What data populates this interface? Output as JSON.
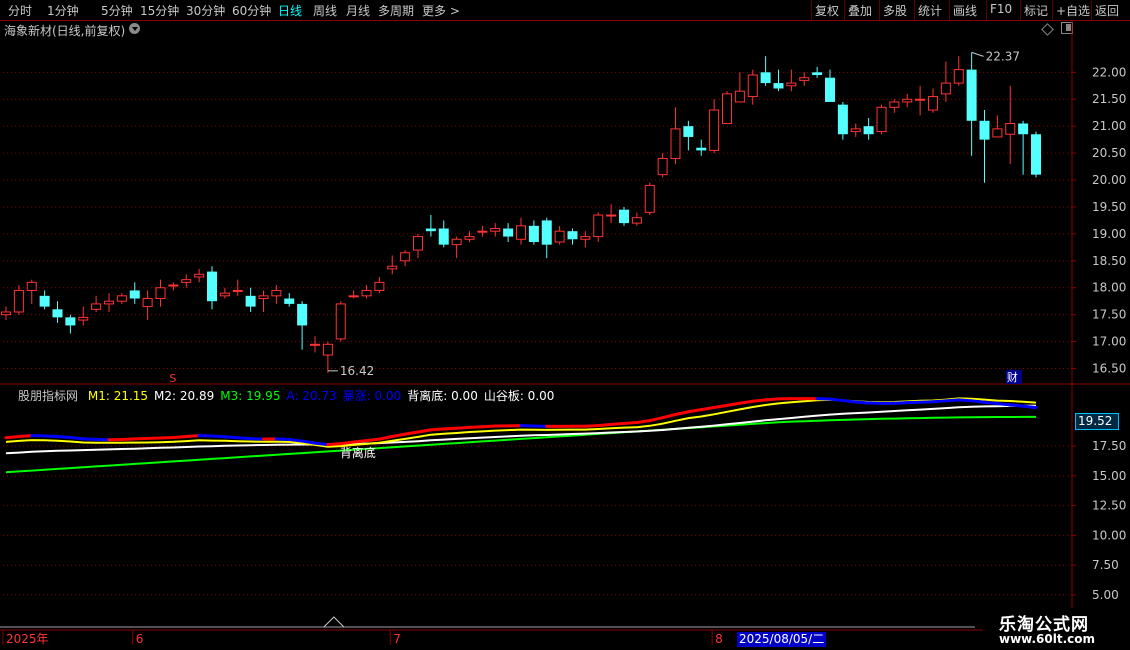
{
  "toolbar": {
    "left": [
      {
        "label": "分时",
        "active": false
      },
      {
        "label": "1分钟",
        "active": false
      },
      {
        "label": "5分钟",
        "active": false
      },
      {
        "label": "15分钟",
        "active": false
      },
      {
        "label": "30分钟",
        "active": false
      },
      {
        "label": "60分钟",
        "active": false
      },
      {
        "label": "日线",
        "active": true
      },
      {
        "label": "周线",
        "active": false
      },
      {
        "label": "月线",
        "active": false
      },
      {
        "label": "多周期",
        "active": false
      },
      {
        "label": "更多 >",
        "active": false
      }
    ],
    "right": [
      "复权",
      "叠加",
      "多股",
      "统计",
      "画线",
      "F10",
      "标记",
      "+自选",
      "返回"
    ]
  },
  "chart_title": "海象新材(日线,前复权)",
  "main_chart": {
    "type": "candlestick",
    "y_ticks": [
      "22.00",
      "21.50",
      "21.00",
      "20.50",
      "20.00",
      "19.50",
      "19.00",
      "18.50",
      "18.00",
      "17.50",
      "17.00",
      "16.50"
    ],
    "ylim": [
      16.25,
      22.6
    ],
    "high_label": "22.37",
    "low_label": "16.42",
    "marker_s": "S",
    "marker_cai": "财",
    "candles": [
      [
        17.5,
        17.55,
        17.4,
        17.65
      ],
      [
        17.55,
        17.95,
        17.5,
        18.05
      ],
      [
        17.95,
        18.1,
        17.7,
        18.15
      ],
      [
        17.85,
        17.65,
        17.6,
        17.95
      ],
      [
        17.6,
        17.45,
        17.35,
        17.75
      ],
      [
        17.45,
        17.3,
        17.15,
        17.5
      ],
      [
        17.4,
        17.45,
        17.3,
        17.65
      ],
      [
        17.6,
        17.7,
        17.55,
        17.85
      ],
      [
        17.7,
        17.75,
        17.55,
        17.9
      ],
      [
        17.75,
        17.85,
        17.7,
        17.9
      ],
      [
        17.95,
        17.8,
        17.7,
        18.1
      ],
      [
        17.65,
        17.8,
        17.4,
        17.95
      ],
      [
        17.8,
        18.0,
        17.65,
        18.15
      ],
      [
        18.05,
        18.05,
        17.95,
        18.1
      ],
      [
        18.1,
        18.15,
        18.0,
        18.25
      ],
      [
        18.2,
        18.25,
        18.1,
        18.35
      ],
      [
        18.3,
        17.75,
        17.6,
        18.4
      ],
      [
        17.85,
        17.9,
        17.8,
        18.0
      ],
      [
        17.95,
        17.95,
        17.85,
        18.15
      ],
      [
        17.85,
        17.65,
        17.55,
        18.0
      ],
      [
        17.8,
        17.85,
        17.55,
        17.95
      ],
      [
        17.85,
        17.95,
        17.7,
        18.05
      ],
      [
        17.8,
        17.7,
        17.65,
        17.9
      ],
      [
        17.7,
        17.3,
        16.85,
        17.75
      ],
      [
        16.95,
        16.95,
        16.8,
        17.1
      ],
      [
        16.75,
        16.95,
        16.42,
        17.0
      ],
      [
        17.05,
        17.7,
        17.0,
        17.75
      ],
      [
        17.85,
        17.85,
        17.8,
        17.95
      ],
      [
        17.85,
        17.95,
        17.8,
        18.05
      ],
      [
        17.95,
        18.1,
        17.9,
        18.2
      ],
      [
        18.35,
        18.4,
        18.25,
        18.6
      ],
      [
        18.5,
        18.65,
        18.4,
        18.7
      ],
      [
        18.7,
        18.95,
        18.55,
        19.0
      ],
      [
        19.1,
        19.05,
        18.95,
        19.35
      ],
      [
        19.1,
        18.8,
        18.75,
        19.25
      ],
      [
        18.8,
        18.9,
        18.55,
        18.95
      ],
      [
        18.9,
        18.95,
        18.85,
        19.05
      ],
      [
        19.05,
        19.05,
        18.95,
        19.15
      ],
      [
        19.05,
        19.1,
        18.95,
        19.2
      ],
      [
        19.1,
        18.95,
        18.85,
        19.2
      ],
      [
        18.9,
        19.15,
        18.8,
        19.3
      ],
      [
        19.15,
        18.85,
        18.8,
        19.25
      ],
      [
        19.25,
        18.8,
        18.55,
        19.3
      ],
      [
        18.85,
        19.05,
        18.8,
        19.15
      ],
      [
        19.05,
        18.9,
        18.8,
        19.1
      ],
      [
        18.9,
        18.95,
        18.75,
        19.05
      ],
      [
        18.95,
        19.35,
        18.85,
        19.4
      ],
      [
        19.35,
        19.35,
        19.2,
        19.55
      ],
      [
        19.45,
        19.2,
        19.15,
        19.5
      ],
      [
        19.2,
        19.3,
        19.15,
        19.4
      ],
      [
        19.4,
        19.9,
        19.35,
        19.95
      ],
      [
        20.1,
        20.4,
        20.05,
        20.5
      ],
      [
        20.4,
        20.95,
        20.3,
        21.35
      ],
      [
        21.0,
        20.8,
        20.55,
        21.1
      ],
      [
        20.6,
        20.55,
        20.45,
        20.75
      ],
      [
        20.55,
        21.3,
        20.5,
        21.5
      ],
      [
        21.05,
        21.6,
        21.05,
        21.65
      ],
      [
        21.45,
        21.65,
        21.45,
        22.0
      ],
      [
        21.55,
        21.95,
        21.4,
        22.05
      ],
      [
        22.0,
        21.8,
        21.75,
        22.3
      ],
      [
        21.8,
        21.7,
        21.65,
        22.05
      ],
      [
        21.75,
        21.8,
        21.65,
        22.05
      ],
      [
        21.85,
        21.9,
        21.75,
        22.0
      ],
      [
        22.0,
        21.95,
        21.9,
        22.1
      ],
      [
        21.9,
        21.45,
        21.45,
        22.05
      ],
      [
        21.4,
        20.85,
        20.75,
        21.45
      ],
      [
        20.9,
        20.95,
        20.8,
        21.05
      ],
      [
        21.0,
        20.85,
        20.75,
        21.15
      ],
      [
        20.9,
        21.35,
        20.85,
        21.4
      ],
      [
        21.35,
        21.45,
        21.25,
        21.5
      ],
      [
        21.45,
        21.5,
        21.35,
        21.6
      ],
      [
        21.5,
        21.5,
        21.2,
        21.75
      ],
      [
        21.3,
        21.55,
        21.25,
        21.7
      ],
      [
        21.6,
        21.8,
        21.45,
        22.2
      ],
      [
        21.8,
        22.05,
        21.75,
        22.3
      ],
      [
        22.05,
        21.1,
        20.45,
        22.37
      ],
      [
        21.1,
        20.75,
        19.95,
        21.3
      ],
      [
        20.8,
        20.95,
        20.85,
        21.2
      ],
      [
        20.85,
        21.05,
        20.3,
        21.75
      ],
      [
        21.05,
        20.85,
        20.1,
        21.1
      ],
      [
        20.85,
        20.1,
        20.05,
        20.9
      ]
    ]
  },
  "sub_chart": {
    "indicator": "股朋指标网",
    "legend": [
      {
        "key": "M1",
        "value": "21.15",
        "color": "#ffff00"
      },
      {
        "key": "M2",
        "value": "20.89",
        "color": "#ffffff"
      },
      {
        "key": "M3",
        "value": "19.95",
        "color": "#00ff00"
      },
      {
        "key": "A",
        "value": "20.73",
        "color": "#0000ff"
      },
      {
        "key": "暴涨",
        "value": "0.00",
        "color": "#0000ff"
      },
      {
        "key": "背离底",
        "value": "0.00",
        "color": "#ffffff"
      },
      {
        "key": "山谷板",
        "value": "0.00",
        "color": "#ffffff"
      }
    ],
    "y_ticks": [
      "17.50",
      "15.00",
      "12.50",
      "10.00",
      "7.50",
      "5.00"
    ],
    "ylim": [
      3.9,
      21.2
    ],
    "current_value": "19.52",
    "annotation": "背离底",
    "series": {
      "M1": [
        17.85,
        17.93,
        18.0,
        17.98,
        17.95,
        17.88,
        17.8,
        17.78,
        17.77,
        17.78,
        17.79,
        17.8,
        17.82,
        17.86,
        17.92,
        17.98,
        17.96,
        17.94,
        17.91,
        17.88,
        17.86,
        17.87,
        17.85,
        17.75,
        17.6,
        17.45,
        17.5,
        17.6,
        17.68,
        17.78,
        17.95,
        18.1,
        18.27,
        18.45,
        18.53,
        18.6,
        18.68,
        18.73,
        18.8,
        18.84,
        18.88,
        18.87,
        18.86,
        18.87,
        18.88,
        18.88,
        18.93,
        19.0,
        19.05,
        19.08,
        19.2,
        19.38,
        19.62,
        19.85,
        19.98,
        20.17,
        20.38,
        20.58,
        20.78,
        20.95,
        21.08,
        21.18,
        21.27,
        21.35,
        21.38,
        21.33,
        21.27,
        21.2,
        21.18,
        21.2,
        21.25,
        21.3,
        21.33,
        21.4,
        21.5,
        21.48,
        21.4,
        21.32,
        21.28,
        21.22,
        21.15
      ],
      "M2": [
        16.9,
        16.95,
        17.02,
        17.06,
        17.1,
        17.13,
        17.16,
        17.19,
        17.22,
        17.25,
        17.28,
        17.31,
        17.35,
        17.38,
        17.42,
        17.46,
        17.49,
        17.52,
        17.55,
        17.57,
        17.59,
        17.61,
        17.62,
        17.63,
        17.63,
        17.63,
        17.65,
        17.68,
        17.71,
        17.75,
        17.8,
        17.85,
        17.91,
        17.98,
        18.04,
        18.1,
        18.15,
        18.21,
        18.26,
        18.31,
        18.36,
        18.4,
        18.43,
        18.47,
        18.51,
        18.55,
        18.59,
        18.64,
        18.68,
        18.72,
        18.78,
        18.85,
        18.94,
        19.03,
        19.12,
        19.22,
        19.33,
        19.44,
        19.55,
        19.66,
        19.76,
        19.86,
        19.96,
        20.06,
        20.14,
        20.21,
        20.27,
        20.32,
        20.38,
        20.44,
        20.5,
        20.56,
        20.62,
        20.69,
        20.76,
        20.8,
        20.83,
        20.85,
        20.87,
        20.88,
        20.89
      ],
      "M3": [
        15.3,
        15.37,
        15.44,
        15.51,
        15.58,
        15.65,
        15.72,
        15.79,
        15.86,
        15.93,
        16.0,
        16.07,
        16.14,
        16.21,
        16.28,
        16.35,
        16.42,
        16.49,
        16.56,
        16.63,
        16.7,
        16.77,
        16.84,
        16.91,
        16.98,
        17.05,
        17.12,
        17.19,
        17.26,
        17.33,
        17.4,
        17.47,
        17.54,
        17.61,
        17.68,
        17.75,
        17.82,
        17.89,
        17.96,
        18.03,
        18.1,
        18.17,
        18.24,
        18.31,
        18.38,
        18.45,
        18.52,
        18.59,
        18.66,
        18.73,
        18.8,
        18.87,
        18.94,
        19.01,
        19.08,
        19.15,
        19.22,
        19.29,
        19.36,
        19.43,
        19.5,
        19.55,
        19.59,
        19.63,
        19.67,
        19.7,
        19.73,
        19.76,
        19.79,
        19.81,
        19.83,
        19.85,
        19.87,
        19.89,
        19.91,
        19.92,
        19.93,
        19.94,
        19.94,
        19.95,
        19.95
      ],
      "A": [
        18.2,
        18.3,
        18.38,
        18.35,
        18.3,
        18.22,
        18.1,
        18.06,
        18.03,
        18.05,
        18.1,
        18.14,
        18.18,
        18.22,
        18.3,
        18.38,
        18.34,
        18.28,
        18.2,
        18.12,
        18.08,
        18.1,
        18.05,
        17.92,
        17.75,
        17.62,
        17.7,
        17.84,
        17.96,
        18.08,
        18.3,
        18.5,
        18.68,
        18.86,
        18.94,
        19.0,
        19.07,
        19.12,
        19.18,
        19.2,
        19.22,
        19.18,
        19.15,
        19.15,
        19.16,
        19.16,
        19.22,
        19.32,
        19.4,
        19.48,
        19.64,
        19.88,
        20.15,
        20.38,
        20.56,
        20.74,
        20.92,
        21.1,
        21.26,
        21.38,
        21.46,
        21.48,
        21.48,
        21.48,
        21.44,
        21.32,
        21.2,
        21.12,
        21.08,
        21.1,
        21.15,
        21.18,
        21.22,
        21.3,
        21.38,
        21.3,
        21.18,
        21.06,
        20.96,
        20.85,
        20.73
      ]
    }
  },
  "x_axis": {
    "labels": [
      {
        "text": "2025年",
        "i": 0
      },
      {
        "text": "6",
        "i": 10
      },
      {
        "text": "7",
        "i": 30
      },
      {
        "text": "8",
        "i": 55
      }
    ],
    "cursor_date": "2025/08/05/二"
  },
  "brand": {
    "name": "乐淘公式网",
    "url": "www.60lt.com"
  },
  "colors": {
    "up": "#ff3333",
    "down": "#54ffff",
    "grid": "#8b0000",
    "m1": "#ffff00",
    "m2": "#ffffff",
    "m3": "#00ff00",
    "a": "#0000ff",
    "hot": "#ff0000"
  }
}
